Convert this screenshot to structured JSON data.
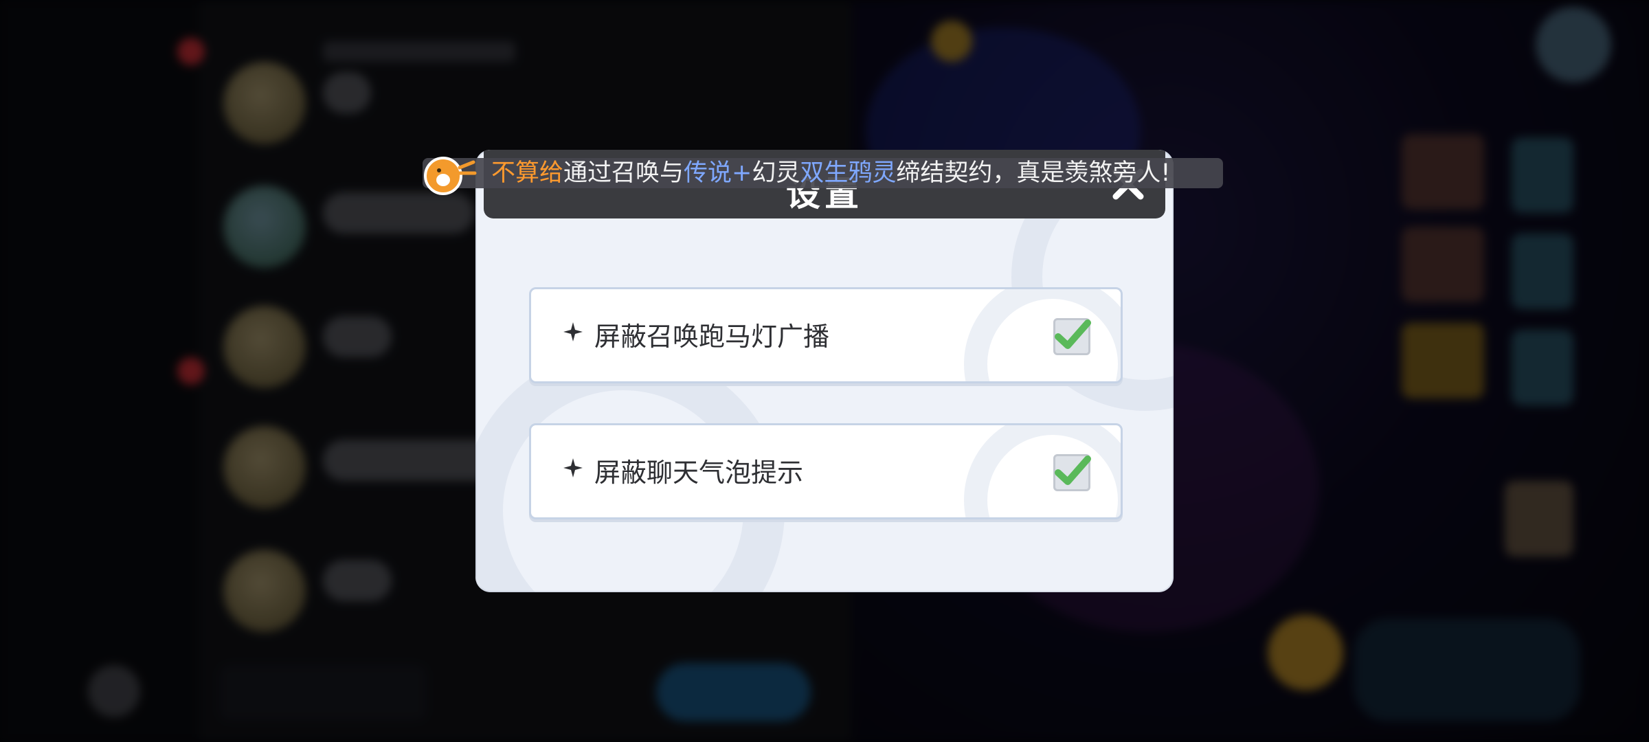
{
  "dialog": {
    "title": "设置",
    "close_icon": "close-icon"
  },
  "settings": [
    {
      "label": "屏蔽召唤跑马灯广播",
      "checked": true,
      "icon": "sparkle-icon"
    },
    {
      "label": "屏蔽聊天气泡提示",
      "checked": true,
      "icon": "sparkle-icon"
    }
  ],
  "marquee": {
    "player": "不算给",
    "text1": "通过召唤与",
    "item1": "传说+",
    "text2": "幻灵",
    "item2": "双生鸦灵",
    "text3": "缔结契约，真是羡煞旁人!",
    "icon": "mascot-icon"
  },
  "colors": {
    "checkmark": "#5ab95a",
    "header": "#3a3b3f",
    "player_name": "#ff9a2e",
    "item_name": "#7fa8ff"
  }
}
